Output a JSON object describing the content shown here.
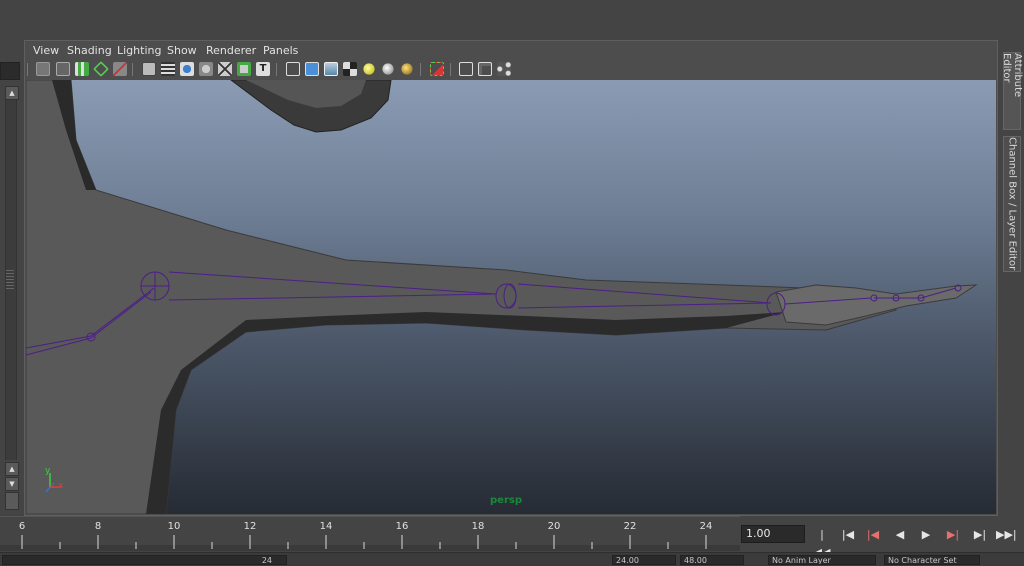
{
  "menu": {
    "items": [
      "View",
      "Shading",
      "Lighting",
      "Show",
      "Renderer",
      "Panels"
    ]
  },
  "toolbar": {
    "icons": [
      "select-camera-icon",
      "camera-attributes-icon",
      "bookmark-icon",
      "image-plane-icon",
      "grid-icon",
      "film-gate-icon",
      "resolution-gate-icon",
      "gate-mask-icon",
      "field-chart-icon",
      "safe-action-icon",
      "safe-title-icon",
      "wireframe-icon",
      "smooth-shade-icon",
      "wireframe-on-shaded-icon",
      "textured-icon",
      "default-lighting-icon",
      "all-lights-icon",
      "shadows-icon",
      "xray-icon",
      "isolate-select-icon",
      "xray-joints-icon"
    ]
  },
  "viewport": {
    "camera_label": "persp",
    "axis": {
      "y": "y",
      "z": "z",
      "x": "x"
    }
  },
  "side_tabs": {
    "attribute_editor": "Attribute Editor",
    "channel_box": "Channel Box / Layer Editor"
  },
  "timeline": {
    "tick_labels": [
      "6",
      "8",
      "10",
      "12",
      "14",
      "16",
      "18",
      "20",
      "22",
      "24"
    ],
    "current_frame": "1.00"
  },
  "playback": {
    "buttons": [
      {
        "name": "go-to-start-icon",
        "glyph": "|◀◀"
      },
      {
        "name": "step-back-icon",
        "glyph": "|◀"
      },
      {
        "name": "step-back-key-icon",
        "glyph": "|◀"
      },
      {
        "name": "play-backward-icon",
        "glyph": "◀"
      },
      {
        "name": "play-forward-icon",
        "glyph": "▶"
      },
      {
        "name": "step-forward-key-icon",
        "glyph": "▶|"
      },
      {
        "name": "step-forward-icon",
        "glyph": "▶|"
      },
      {
        "name": "go-to-end-icon",
        "glyph": "▶▶|"
      }
    ]
  },
  "range": {
    "end_time": "24",
    "start_value": "24.00",
    "end_value": "48.00",
    "anim_layer": "No Anim Layer",
    "character_set": "No Character Set"
  },
  "colors": {
    "joint": "#4b1f86",
    "persp_label": "#1a8a3a",
    "mesh_dark": "#2c2c2c",
    "mesh_mid": "#5a5a5a"
  }
}
